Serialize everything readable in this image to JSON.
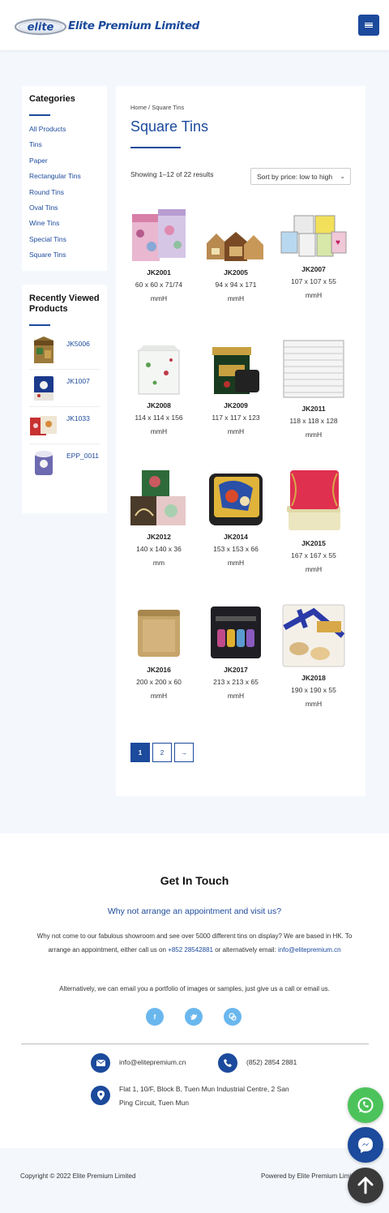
{
  "header": {
    "logo_mark": "elite",
    "logo_text": "Elite Premium Limited",
    "menu_icon": "hamburger-icon"
  },
  "sidebar": {
    "categories_title": "Categories",
    "categories": [
      "All Products",
      "Tins",
      "Paper",
      "Rectangular Tins",
      "Round Tins",
      "Oval Tins",
      "Wine Tins",
      "Special Tins",
      "Square Tins"
    ],
    "recent_title": "Recently Viewed Products",
    "recent": [
      {
        "label": "JK5006"
      },
      {
        "label": "JK1007"
      },
      {
        "label": "JK1033"
      },
      {
        "label": "EPP_0011"
      }
    ]
  },
  "main": {
    "breadcrumb": "Home / Square Tins",
    "title": "Square Tins",
    "result_count": "Showing 1–12 of 22 results",
    "sort_value": "Sort by price: low to high",
    "products": [
      {
        "name": "JK2001",
        "size_a": "60 x 60 x 71/74",
        "size_b": "mmH"
      },
      {
        "name": "JK2005",
        "size_a": "94 x 94 x 171",
        "size_b": "mmH"
      },
      {
        "name": "JK2007",
        "size_a": "107 x 107 x 55",
        "size_b": "mmH"
      },
      {
        "name": "JK2008",
        "size_a": "114 x 114 x 156",
        "size_b": "mmH"
      },
      {
        "name": "JK2009",
        "size_a": "117 x 117 x 123",
        "size_b": "mmH"
      },
      {
        "name": "JK2011",
        "size_a": "118 x 118 x 128",
        "size_b": "mmH"
      },
      {
        "name": "JK2012",
        "size_a": "140 x 140 x 36",
        "size_b": "mm"
      },
      {
        "name": "JK2014",
        "size_a": "153 x 153 x 66",
        "size_b": "mmH"
      },
      {
        "name": "JK2015",
        "size_a": "167 x 167 x 55",
        "size_b": "mmH"
      },
      {
        "name": "JK2016",
        "size_a": "200 x 200 x 60",
        "size_b": "mmH"
      },
      {
        "name": "JK2017",
        "size_a": "213 x 213 x 65",
        "size_b": "mmH"
      },
      {
        "name": "JK2018",
        "size_a": "190 x 190 x 55",
        "size_b": "mmH"
      }
    ],
    "pagination": {
      "page1": "1",
      "page2": "2",
      "next": "→"
    }
  },
  "contact": {
    "title": "Get In Touch",
    "subtitle": "Why not arrange an appointment and visit us?",
    "para_1": "Why not come to our fabulous showroom and see over 5000 different tins on display? We are based in HK. To arrange an appointment, either call us on",
    "phone_link": "+852 28542881",
    "para_2": "or alternatively email:",
    "email_link": "info@elitepremium.cn",
    "para_3": "Alternatively, we can email you a portfolio of images or samples, just give us a call or email us.",
    "email": "info@elitepremium.cn",
    "phone": "(852) 2854 2881",
    "address_1": "Flat 1, 10/F, Block B, Tuen Mun Industrial Centre, 2 San",
    "address_2": "Ping Circuit, Tuen Mun"
  },
  "footer": {
    "copyright": "Copyright © 2022 Elite Premium Limited",
    "powered": "Powered by Elite Premium Limited"
  },
  "colors": {
    "brand": "#1c4a9c",
    "whatsapp": "#4cc35a",
    "messenger": "#1c4a9c",
    "scroll_top": "#3a3a3a"
  }
}
